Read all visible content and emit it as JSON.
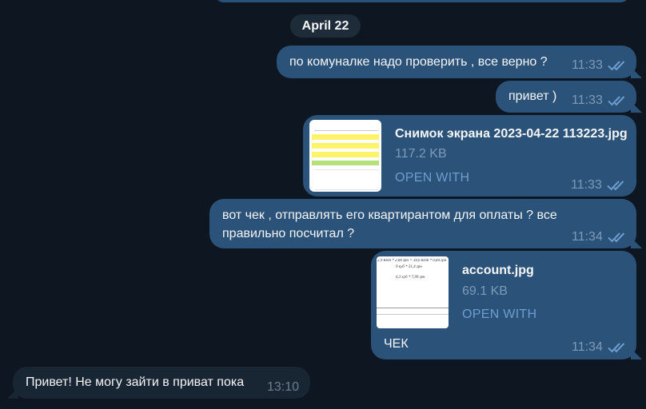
{
  "date_separator": "April 22",
  "messages": [
    {
      "text": "по комуналке надо проверить , все верно ?",
      "time": "11:33"
    },
    {
      "text": "привет )",
      "time": "11:33"
    },
    {
      "file_name": "Снимок экрана 2023-04-22 113223.jpg",
      "file_size": "117.2 KB",
      "action": "OPEN WITH",
      "time": "11:33"
    },
    {
      "line1": "вот чек , отправлять его квартирантом для оплаты ? все",
      "line2": "правильно посчитал ?",
      "time": "11:34"
    },
    {
      "file_name": "account.jpg",
      "file_size": "69.1 KB",
      "action": "OPEN WITH",
      "caption": "ЧЕК",
      "time": "11:34",
      "thumb_lines": [
        "2,9 Кбт * 2,68 грн = 34,6 Кбт * 0,84 грн",
        "9 куб * 31,4 грн",
        "6,3 куб * 7,99 грн"
      ]
    },
    {
      "text": "Привет! Не могу зайти в приват пока",
      "time": "13:10"
    }
  ],
  "colors": {
    "background": "#0e1621",
    "outgoing_bubble": "#2b5278",
    "incoming_bubble": "#182533",
    "accent": "#6e9dd0",
    "thumb_yellow": "#fff36a",
    "thumb_green": "#b6e07a"
  },
  "icons": {
    "read_receipt": "double-check-icon"
  }
}
